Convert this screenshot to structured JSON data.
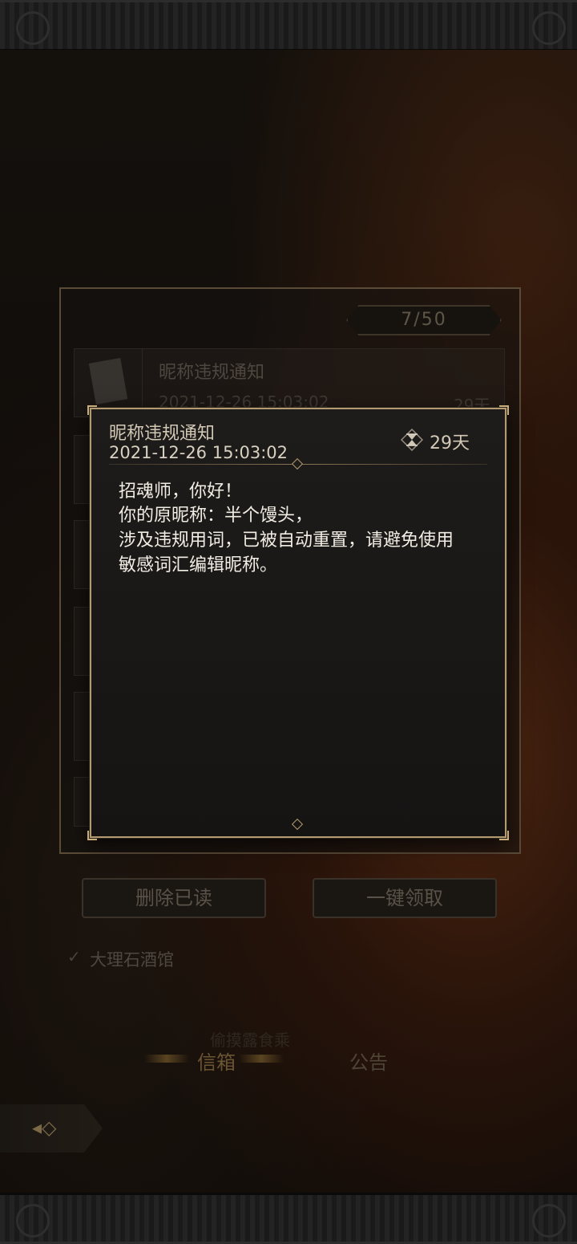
{
  "mailbox": {
    "page_counter": "7/50",
    "item": {
      "title": "昵称违规通知",
      "date": "2021-12-26 15:03:02",
      "days": "29天"
    },
    "buttons": {
      "delete_read": "删除已读",
      "claim_all": "一键领取"
    },
    "location_label": "大理石酒馆",
    "faded_text": "偷摸露食乘",
    "tabs": [
      {
        "label": "信箱",
        "active": true
      },
      {
        "label": "公告",
        "active": false
      }
    ]
  },
  "detail": {
    "title": "昵称违规通知",
    "date": "2021-12-26 15:03:02",
    "days": "29天",
    "body_lines": [
      "招魂师，你好！",
      "你的原昵称：半个馒头，",
      "涉及违规用词，已被自动重置，请避免使用",
      "敏感词汇编辑昵称。"
    ]
  },
  "colors": {
    "accent_gold": "#b39a70",
    "popup_bg": "#1a1816",
    "body_text": "#f2ede4"
  }
}
